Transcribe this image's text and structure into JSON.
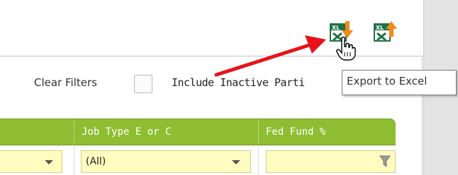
{
  "toolbar": {
    "clear_filters_label": "Clear Filters",
    "include_inactive_label": "Include Inactive Parti"
  },
  "tooltip": {
    "text": "Export to Excel"
  },
  "icons": {
    "export": "excel-export-icon",
    "import": "excel-import-icon",
    "cursor": "hand-pointer-cursor-icon",
    "annotation": "red-arrow-annotation"
  },
  "grid": {
    "columns": [
      {
        "header": ""
      },
      {
        "header": "Job Type E or C"
      },
      {
        "header": "Fed Fund %"
      }
    ],
    "filters": [
      {
        "value": ""
      },
      {
        "value": "(All)"
      },
      {
        "value": ""
      }
    ]
  },
  "colors": {
    "header_green": "#8fbd32",
    "filter_yellow": "#fffcbf",
    "arrow_red": "#e8131b",
    "excel_green": "#1e7145",
    "arrow_orange": "#f08a1a"
  }
}
